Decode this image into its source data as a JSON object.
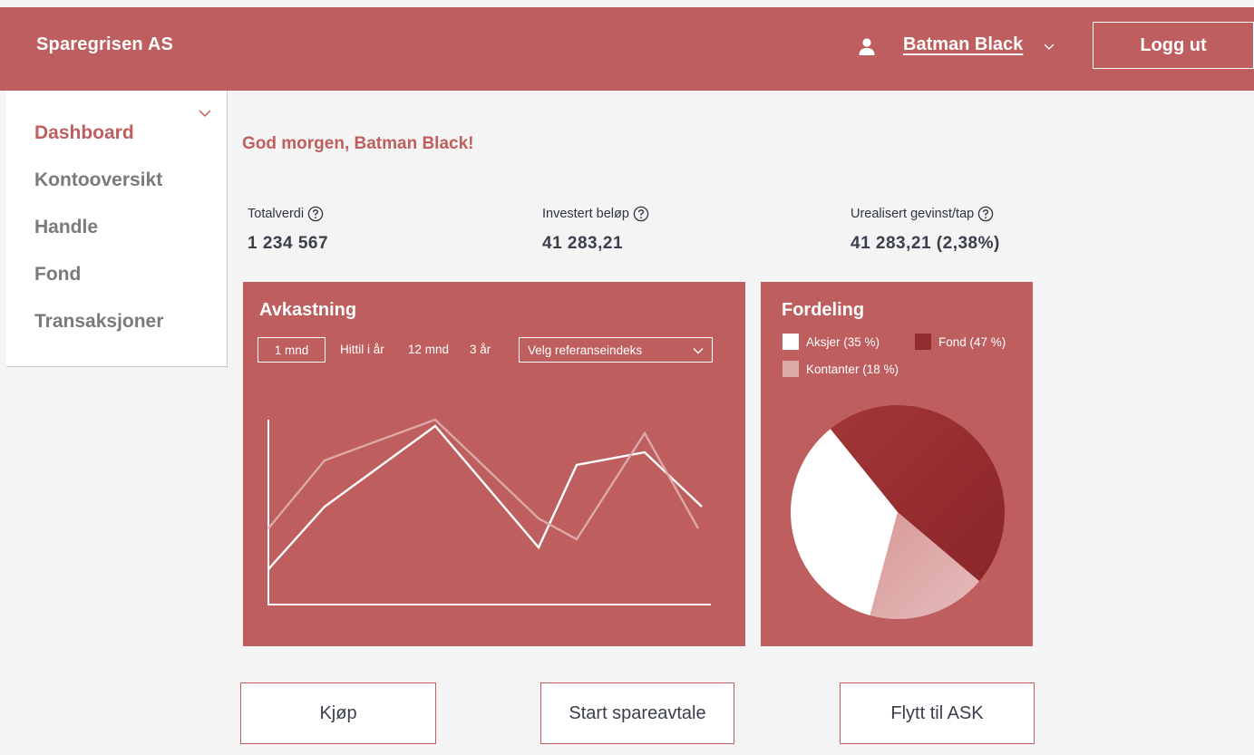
{
  "header": {
    "brand": "Sparegrisen AS",
    "user_name": "Batman Black",
    "logout_label": "Logg ut"
  },
  "sidebar": {
    "items": [
      {
        "label": "Dashboard",
        "active": true
      },
      {
        "label": "Kontooversikt",
        "active": false
      },
      {
        "label": "Handle",
        "active": false
      },
      {
        "label": "Fond",
        "active": false
      },
      {
        "label": "Transaksjoner",
        "active": false
      }
    ]
  },
  "main": {
    "greeting": "God morgen, Batman Black!",
    "stats": [
      {
        "label": "Totalverdi",
        "value": "1 234 567"
      },
      {
        "label": "Investert beløp",
        "value": "41 283,21"
      },
      {
        "label": "Urealisert gevinst/tap",
        "value": "41 283,21 (2,38%)"
      }
    ]
  },
  "returns_panel": {
    "title": "Avkastning",
    "ranges": [
      "1 mnd",
      "Hittil i år",
      "12 mnd",
      "3 år"
    ],
    "selected_range": "1 mnd",
    "select_placeholder": "Velg referanseindeks"
  },
  "distribution_panel": {
    "title": "Fordeling"
  },
  "actions": {
    "buy": "Kjøp",
    "start_saving": "Start spareavtale",
    "move_ask": "Flytt til ASK"
  },
  "colors": {
    "brand": "#be5e5e",
    "page_bg": "#f4f4f4",
    "dark_red": "#932c2e",
    "light_pink": "#dca9a9",
    "white": "#ffffff"
  },
  "icons": {
    "user": "user-icon",
    "help": "help-circle-icon",
    "chevron": "chevron-down-icon"
  },
  "chart_data": [
    {
      "type": "line",
      "title": "Avkastning",
      "x": [
        0,
        1,
        2,
        3,
        4,
        5,
        6,
        7,
        8,
        9,
        10,
        11
      ],
      "series": [
        {
          "color": "#ffffff",
          "values": [
            20,
            52,
            null,
            95,
            null,
            30,
            72,
            75,
            52,
            null,
            null,
            null
          ]
        },
        {
          "color": "#dca9a9",
          "values": [
            45,
            80,
            null,
            99,
            null,
            43,
            36,
            88,
            40,
            null,
            null,
            null
          ]
        }
      ],
      "grid": false,
      "axes": {
        "left": true,
        "bottom": true,
        "ticks": false
      }
    },
    {
      "type": "pie",
      "title": "Fordeling",
      "slices": [
        {
          "label": "Aksjer (35 %)",
          "value": 35,
          "color": "#ffffff"
        },
        {
          "label": "Fond (47 %)",
          "value": 47,
          "color": "#932c2e"
        },
        {
          "label": "Kontanter (18 %)",
          "value": 18,
          "color": "#dca9a9"
        }
      ],
      "legend": "top"
    }
  ]
}
